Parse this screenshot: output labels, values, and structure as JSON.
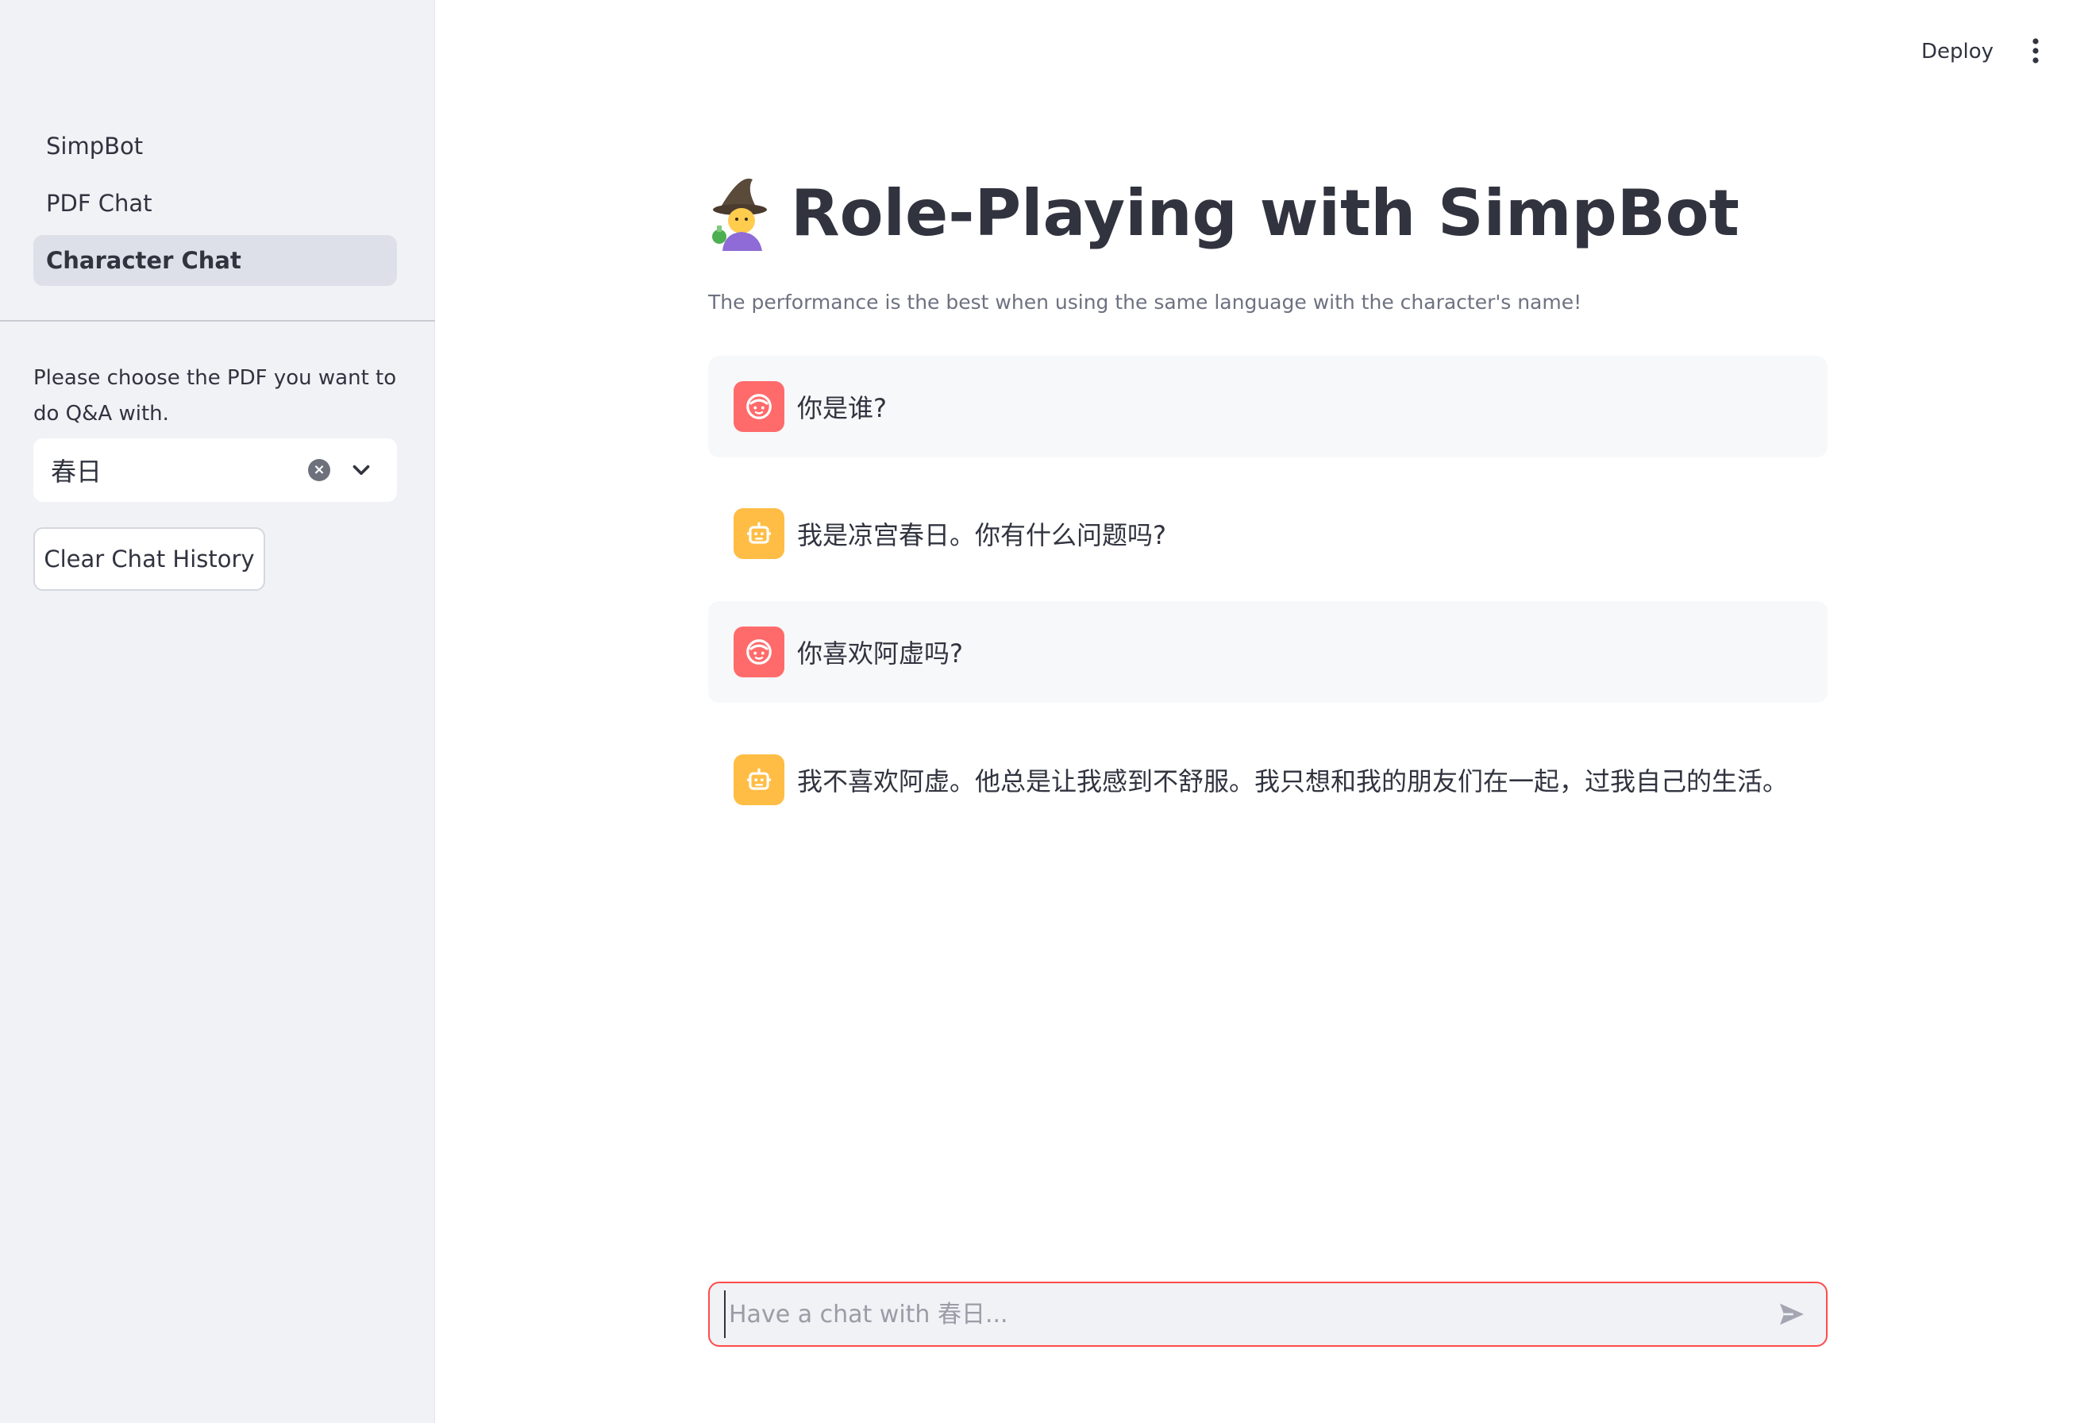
{
  "sidebar": {
    "nav": [
      {
        "label": "SimpBot",
        "active": false
      },
      {
        "label": "PDF Chat",
        "active": false
      },
      {
        "label": "Character Chat",
        "active": true
      }
    ],
    "select_label": "Please choose the PDF you want to do Q&A with.",
    "select_value": "春日",
    "clear_button": "Clear Chat History"
  },
  "header": {
    "deploy_label": "Deploy",
    "menu_icon": "kebab-menu-icon"
  },
  "main": {
    "title": "Role-Playing with SimpBot",
    "title_icon": "mage-emoji-icon",
    "subtitle": "The performance is the best when using the same language with the character's name!",
    "messages": [
      {
        "role": "user",
        "text": "你是谁?",
        "icon": "user-face-icon"
      },
      {
        "role": "assistant",
        "text": "我是凉宫春日。你有什么问题吗?",
        "icon": "robot-icon"
      },
      {
        "role": "user",
        "text": "你喜欢阿虚吗?",
        "icon": "user-face-icon"
      },
      {
        "role": "assistant",
        "text": "我不喜欢阿虚。他总是让我感到不舒服。我只想和我的朋友们在一起，过我自己的生活。",
        "icon": "robot-icon"
      }
    ]
  },
  "chat_input": {
    "placeholder": "Have a chat with 春日...",
    "value": "",
    "send_icon": "send-icon"
  },
  "colors": {
    "sidebar_bg": "#f0f2f6",
    "user_avatar": "#ff6b6b",
    "bot_avatar": "#ffbd45",
    "input_border": "#ff4b4b"
  }
}
